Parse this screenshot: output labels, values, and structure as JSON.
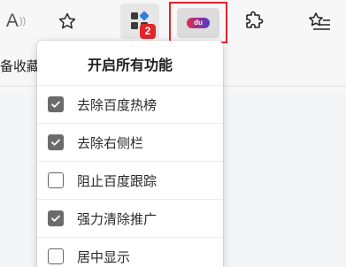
{
  "toolbar": {
    "read_aloud_glyph": "A",
    "extension_badge_count": "2",
    "du_logo_text": "du"
  },
  "favorites_bar": {
    "partial_text": "备收藏"
  },
  "popup": {
    "title": "开启所有功能",
    "options": [
      {
        "label": "去除百度热榜",
        "checked": true
      },
      {
        "label": "去除右侧栏",
        "checked": true
      },
      {
        "label": "阻止百度跟踪",
        "checked": false
      },
      {
        "label": "强力清除推广",
        "checked": true
      },
      {
        "label": "居中显示",
        "checked": false
      }
    ]
  },
  "colors": {
    "highlight_border": "#e1252b",
    "checkbox_checked": "#6b6b6b",
    "badge": "#e1252b"
  }
}
